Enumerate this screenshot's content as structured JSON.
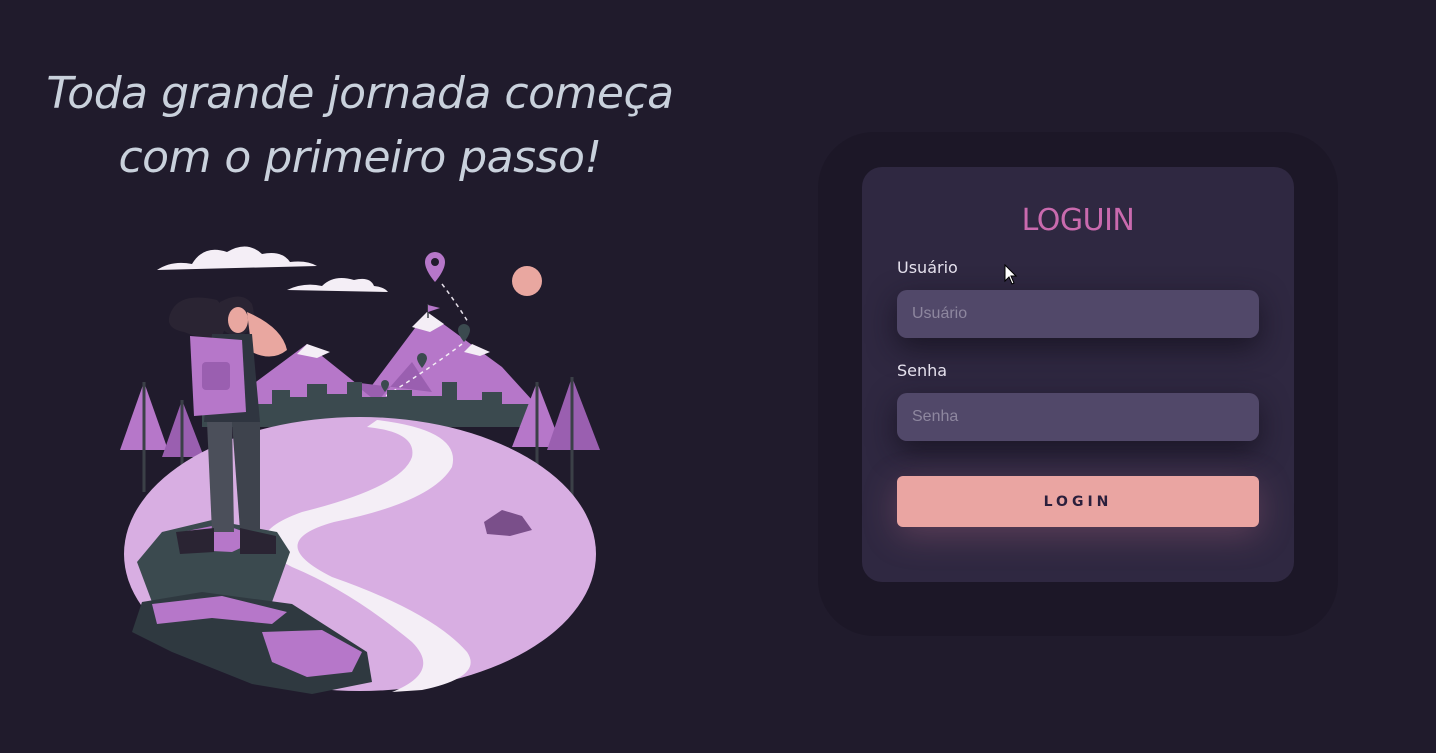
{
  "hero": {
    "headline_line1": "Toda grande jornada começa",
    "headline_line2": "com o primeiro passo!",
    "illustration": "hiker-on-mountain-path"
  },
  "login_card": {
    "title": "LOGUIN",
    "username_label": "Usuário",
    "username_placeholder": "Usuário",
    "username_value": "",
    "password_label": "Senha",
    "password_placeholder": "Senha",
    "password_value": "",
    "submit_label": "LOGIN"
  },
  "colors": {
    "background": "#201b2c",
    "card": "#2f2841",
    "input": "#514869",
    "title_accent": "#c96aae",
    "button": "#eaa5a2",
    "illustration_purple": "#b677c9",
    "illustration_light": "#d8aee2"
  }
}
